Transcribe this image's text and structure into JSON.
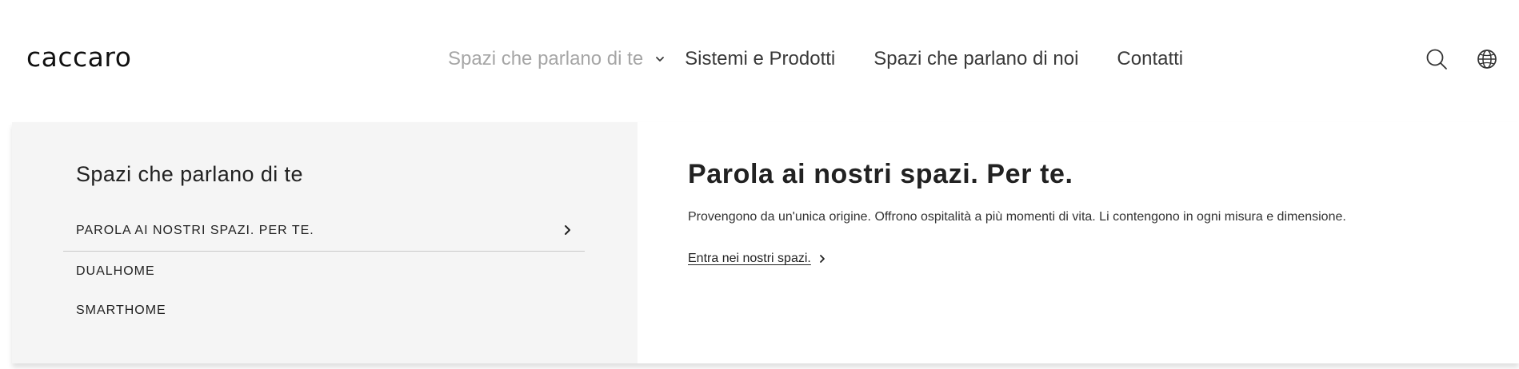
{
  "brand": {
    "logo_text": "caccaro"
  },
  "nav": {
    "items": [
      {
        "label": "Spazi che parlano di te",
        "active": true,
        "has_dropdown": true
      },
      {
        "label": "Sistemi e Prodotti"
      },
      {
        "label": "Spazi che parlano di noi"
      },
      {
        "label": "Contatti"
      }
    ]
  },
  "header_icons": {
    "search": "search-icon",
    "language": "globe-icon"
  },
  "dropdown": {
    "section_title": "Spazi che parlano di te",
    "menu": [
      {
        "label": "PAROLA AI NOSTRI SPAZI. PER TE.",
        "selected": true
      },
      {
        "label": "DUALHOME"
      },
      {
        "label": "SMARTHOME"
      }
    ],
    "feature": {
      "title": "Parola ai nostri spazi. Per te.",
      "description": "Provengono da un'unica origine. Offrono ospitalità a più momenti di vita. Li contengono in ogni misura e dimensione.",
      "link_label": "Entra nei nostri spazi."
    }
  },
  "colors": {
    "nav_active": "#a6a6a6",
    "nav_text": "#3a3a3a",
    "panel_left_bg": "#f5f5f5",
    "divider": "#c9c9c9"
  }
}
